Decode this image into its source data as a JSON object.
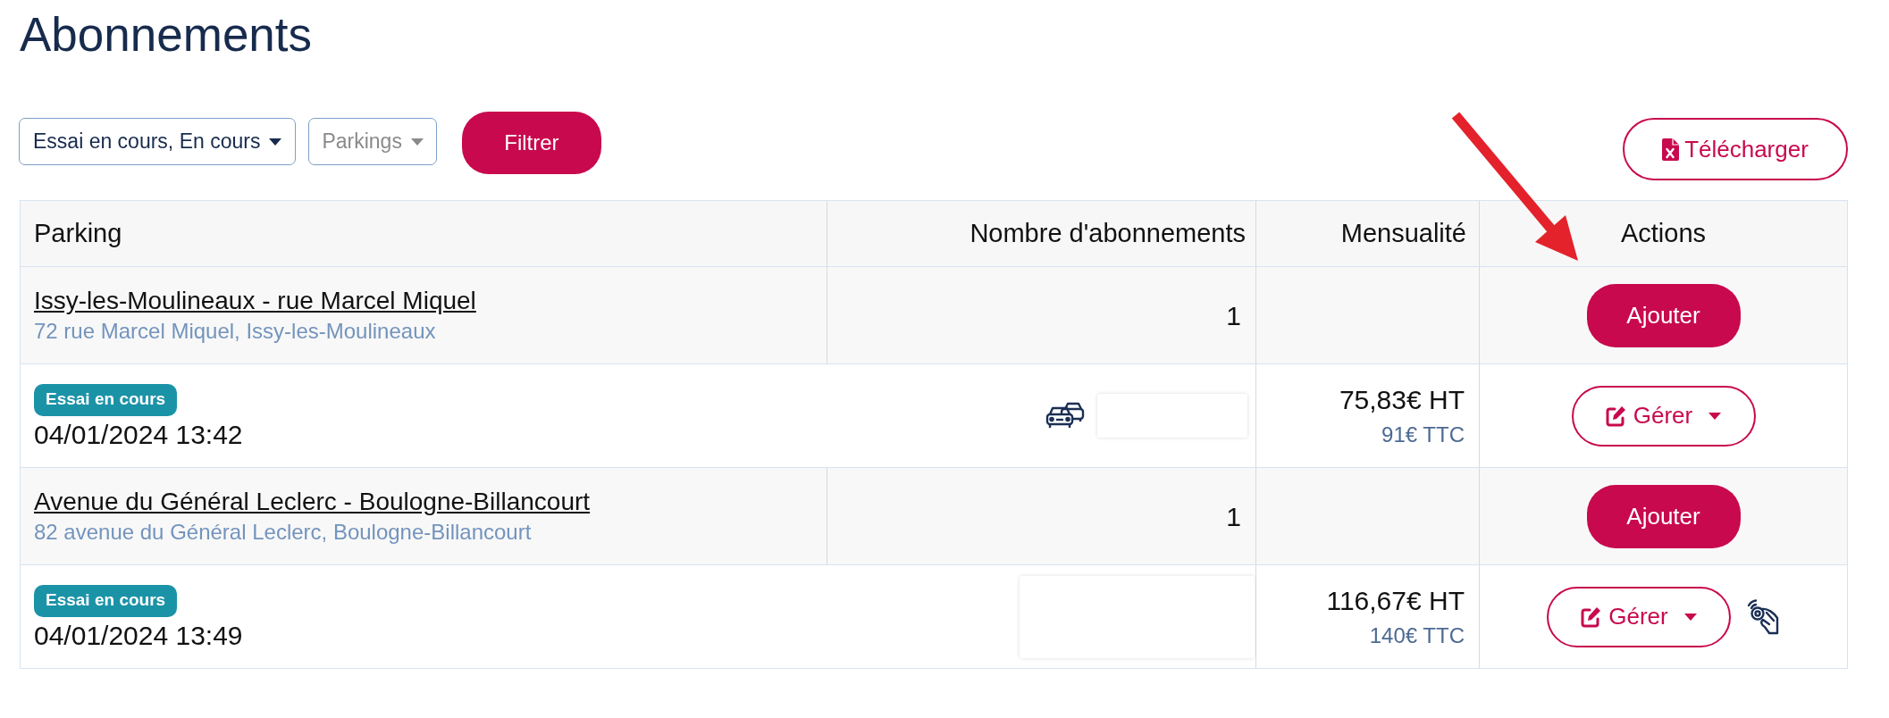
{
  "page": {
    "title": "Abonnements"
  },
  "filters": {
    "status_select": {
      "value": "Essai en cours, En cours"
    },
    "parking_select": {
      "placeholder": "Parkings"
    },
    "filter_button": "Filtrer"
  },
  "download_button": "Télécharger",
  "table": {
    "columns": [
      "Parking",
      "Nombre d'abonnements",
      "Mensualité",
      "Actions"
    ],
    "rows": [
      {
        "kind": "parking",
        "name": "Issy-les-Moulineaux - rue Marcel Miquel",
        "address": "72 rue Marcel Miquel, Issy-les-Moulineaux",
        "count": "1",
        "action": "Ajouter"
      },
      {
        "kind": "subscription",
        "status": "Essai en cours",
        "date": "04/01/2024 13:42",
        "vehicle": true,
        "badge_access": false,
        "price_ht": "75,83€ HT",
        "price_ttc": "91€ TTC",
        "action": "Gérer"
      },
      {
        "kind": "parking",
        "name": "Avenue du Général Leclerc - Boulogne-Billancourt",
        "address": "82 avenue du Général Leclerc, Boulogne-Billancourt",
        "count": "1",
        "action": "Ajouter"
      },
      {
        "kind": "subscription",
        "status": "Essai en cours",
        "date": "04/01/2024 13:49",
        "vehicle": false,
        "badge_access": true,
        "price_ht": "116,67€ HT",
        "price_ttc": "140€ TTC",
        "action": "Gérer"
      }
    ]
  }
}
